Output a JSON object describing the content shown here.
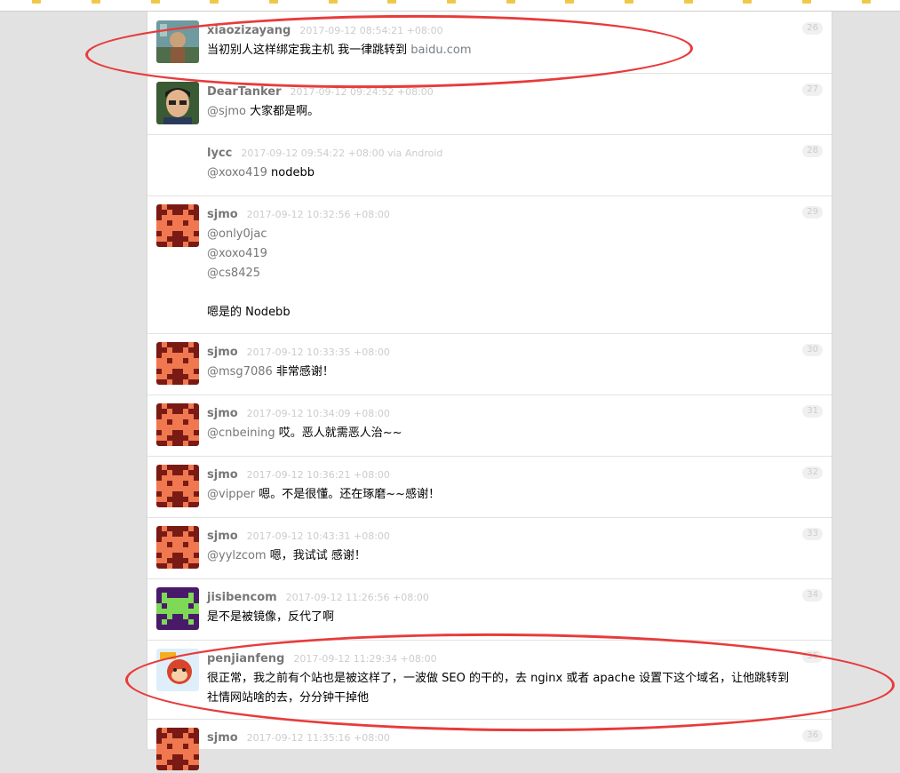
{
  "replies": [
    {
      "user": "xiaozizayang",
      "time": "2017-09-12 08:54:21 +08:00",
      "num": "26",
      "lines": [
        {
          "text": "当初别人这样绑定我主机 我一律跳转到 ",
          "link": "baidu.com"
        }
      ]
    },
    {
      "user": "DearTanker",
      "time": "2017-09-12 09:24:52 +08:00",
      "num": "27",
      "lines": [
        {
          "mention": "@sjmo",
          "text": " 大家都是啊。"
        }
      ]
    },
    {
      "user": "lycc",
      "time": "2017-09-12 09:54:22 +08:00 via Android",
      "num": "28",
      "lines": [
        {
          "mention": "@xoxo419",
          "text": " nodebb"
        }
      ]
    },
    {
      "user": "sjmo",
      "time": "2017-09-12 10:32:56 +08:00",
      "num": "29",
      "lines": [
        {
          "mention": "@only0jac"
        },
        {
          "mention": "@xoxo419"
        },
        {
          "mention": "@cs8425"
        },
        {},
        {
          "text": "嗯是的 Nodebb"
        }
      ]
    },
    {
      "user": "sjmo",
      "time": "2017-09-12 10:33:35 +08:00",
      "num": "30",
      "lines": [
        {
          "mention": "@msg7086",
          "text": " 非常感谢！"
        }
      ]
    },
    {
      "user": "sjmo",
      "time": "2017-09-12 10:34:09 +08:00",
      "num": "31",
      "lines": [
        {
          "mention": "@cnbeining",
          "text": " 哎。恶人就需恶人治~~"
        }
      ]
    },
    {
      "user": "sjmo",
      "time": "2017-09-12 10:36:21 +08:00",
      "num": "32",
      "lines": [
        {
          "mention": "@vipper",
          "text": " 嗯。不是很懂。还在琢磨~~感谢！"
        }
      ]
    },
    {
      "user": "sjmo",
      "time": "2017-09-12 10:43:31 +08:00",
      "num": "33",
      "lines": [
        {
          "mention": "@yylzcom",
          "text": " 嗯，我试试 感谢！"
        }
      ]
    },
    {
      "user": "jisibencom",
      "time": "2017-09-12 11:26:56 +08:00",
      "num": "34",
      "lines": [
        {
          "text": "是不是被镜像，反代了啊"
        }
      ]
    },
    {
      "user": "penjianfeng",
      "time": "2017-09-12 11:29:34 +08:00",
      "num": "35",
      "lines": [
        {
          "text": "很正常，我之前有个站也是被这样了，一波做 SEO 的干的，去 nginx 或者 apache 设置下这个域名，让他跳转到"
        },
        {
          "text": "社情网站啥的去，分分钟干掉他"
        }
      ]
    },
    {
      "user": "sjmo",
      "time": "2017-09-12 11:35:16 +08:00",
      "num": "36",
      "lines": []
    }
  ],
  "colors": {
    "annotation": "#e83b3b",
    "username": "#777777",
    "timestamp": "#cccccc"
  }
}
